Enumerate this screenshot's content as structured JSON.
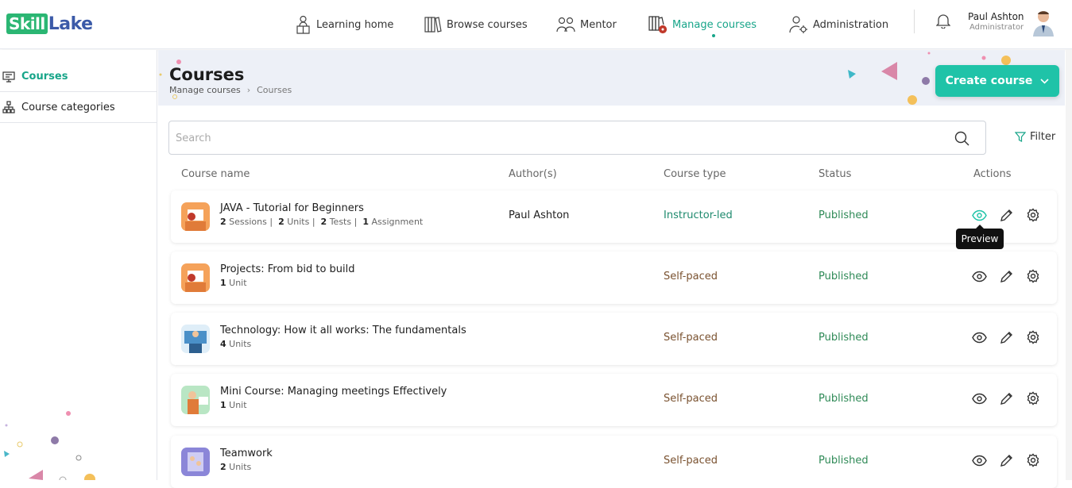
{
  "app": {
    "logo_part1": "Skill",
    "logo_part2": "Lake"
  },
  "nav": [
    {
      "label": "Learning home",
      "icon": "learning-home-icon"
    },
    {
      "label": "Browse courses",
      "icon": "books-icon"
    },
    {
      "label": "Mentor",
      "icon": "mentor-icon"
    },
    {
      "label": "Manage courses",
      "icon": "manage-courses-icon",
      "active": true
    },
    {
      "label": "Administration",
      "icon": "administration-icon"
    }
  ],
  "user": {
    "name": "Paul Ashton",
    "role": "Administrator"
  },
  "sidebar": {
    "items": [
      {
        "label": "Courses",
        "active": true
      },
      {
        "label": "Course categories"
      }
    ]
  },
  "page": {
    "title": "Courses",
    "breadcrumb": [
      "Manage courses",
      "Courses"
    ],
    "create_label": "Create course"
  },
  "search": {
    "placeholder": "Search"
  },
  "filter_label": "Filter",
  "table": {
    "headers": [
      "Course name",
      "Author(s)",
      "Course type",
      "Status",
      "Actions"
    ],
    "rows": [
      {
        "title": "JAVA - Tutorial for Beginners",
        "meta": [
          [
            "2",
            "Sessions"
          ],
          [
            "2",
            "Units"
          ],
          [
            "2",
            "Tests"
          ],
          [
            "1",
            "Assignment"
          ]
        ],
        "author": "Paul Ashton",
        "type": "Instructor-led",
        "status": "Published"
      },
      {
        "title": "Projects: From bid to build",
        "meta": [
          [
            "1",
            "Unit"
          ]
        ],
        "author": "",
        "type": "Self-paced",
        "status": "Published"
      },
      {
        "title": "Technology: How it all works: The fundamentals",
        "meta": [
          [
            "4",
            "Units"
          ]
        ],
        "author": "",
        "type": "Self-paced",
        "status": "Published"
      },
      {
        "title": "Mini Course: Managing meetings Effectively",
        "meta": [
          [
            "1",
            "Unit"
          ]
        ],
        "author": "",
        "type": "Self-paced",
        "status": "Published"
      },
      {
        "title": "Teamwork",
        "meta": [
          [
            "2",
            "Units"
          ]
        ],
        "author": "",
        "type": "Self-paced",
        "status": "Published"
      }
    ]
  },
  "tooltip": "Preview",
  "colors": {
    "accent": "#17a589",
    "button": "#1fc3a8",
    "published": "#2f8a57",
    "instructor": "#1f8a6e",
    "selfpaced": "#7a5230"
  }
}
